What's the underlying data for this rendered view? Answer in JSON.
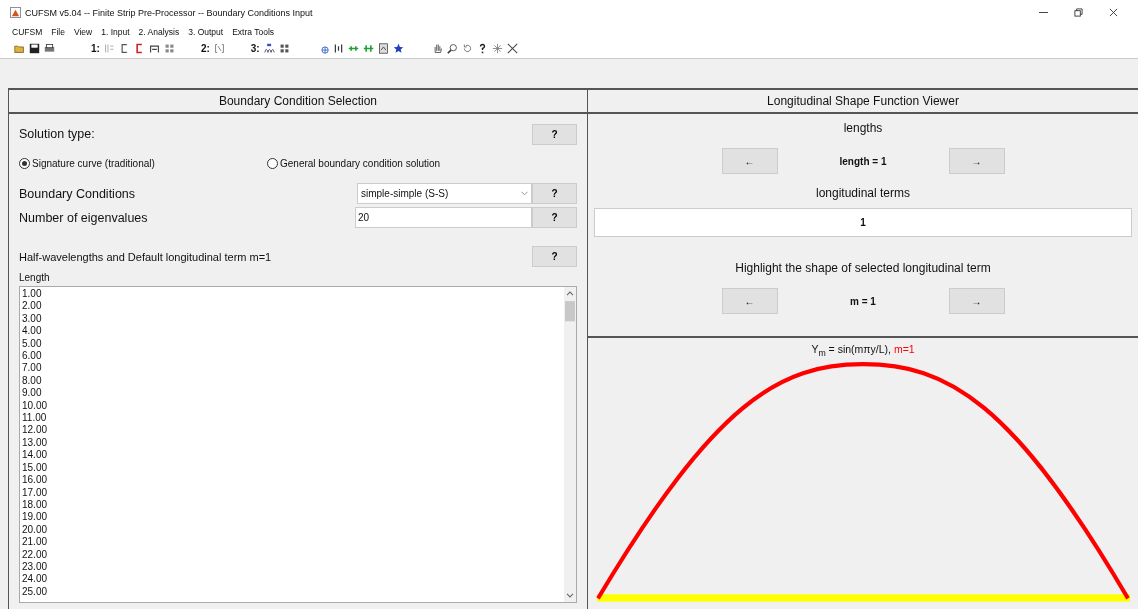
{
  "window": {
    "title": "CUFSM v5.04 -- Finite Strip Pre-Processor -- Boundary Conditions Input"
  },
  "menu": [
    "CUFSM",
    "File",
    "View",
    "1. Input",
    "2. Analysis",
    "3. Output",
    "Extra Tools"
  ],
  "toolbar": {
    "section_labels": [
      "1:",
      "2:",
      "3:"
    ]
  },
  "selection_panel": {
    "title": "Boundary Condition Selection",
    "solution_type_label": "Solution type:",
    "solution_type_help": "?",
    "solution_types": [
      {
        "label": "Signature curve (traditional)",
        "selected": true
      },
      {
        "label": "General boundary condition solution",
        "selected": false
      }
    ],
    "boundary_conditions": {
      "label": "Boundary Conditions",
      "value": "simple-simple (S-S)",
      "help": "?"
    },
    "eigenvalues": {
      "label": "Number of eigenvalues",
      "value": "20",
      "help": "?"
    },
    "half_wavelengths": {
      "label": "Half-wavelengths and Default longitudinal term m=1",
      "help": "?"
    },
    "lengths": {
      "label": "Length",
      "values": [
        "1.00",
        "2.00",
        "3.00",
        "4.00",
        "5.00",
        "6.00",
        "7.00",
        "8.00",
        "9.00",
        "10.00",
        "11.00",
        "12.00",
        "13.00",
        "14.00",
        "15.00",
        "16.00",
        "17.00",
        "18.00",
        "19.00",
        "20.00",
        "21.00",
        "22.00",
        "23.00",
        "24.00",
        "25.00"
      ]
    }
  },
  "viewer": {
    "title": "Longitudinal Shape Function Viewer",
    "lengths_label": "lengths",
    "length_nav": {
      "prev": "←",
      "value": "length = 1",
      "next": "→"
    },
    "terms_label": "longitudinal terms",
    "terms_value": "1",
    "highlight_label": "Highlight the shape of selected longitudinal term",
    "term_nav": {
      "prev": "←",
      "value": "m = 1",
      "next": "→"
    },
    "formula": "Y$_{m}$ = sin(mπy/L), ",
    "formula_term": "m=1"
  }
}
